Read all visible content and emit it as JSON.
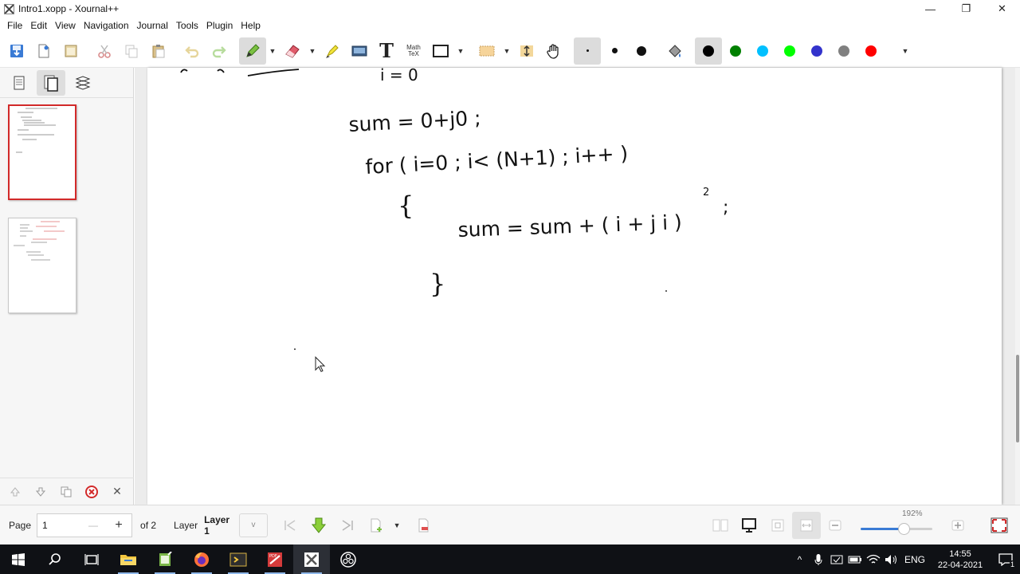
{
  "window": {
    "title": "Intro1.xopp - Xournal++",
    "minimize": "—",
    "restore": "❐",
    "close": "✕"
  },
  "menu": [
    "File",
    "Edit",
    "View",
    "Navigation",
    "Journal",
    "Tools",
    "Plugin",
    "Help"
  ],
  "toolbar": {
    "tools": [
      "save-icon",
      "new-page-icon",
      "open-icon",
      "cut-icon",
      "copy-icon",
      "paste-icon",
      "undo-icon",
      "redo-icon",
      "pen-icon",
      "eraser-icon",
      "highlighter-icon",
      "image-icon",
      "text-icon",
      "math-tex-icon",
      "shape-rectangle-icon",
      "select-rect-icon",
      "vertical-space-icon",
      "hand-icon"
    ],
    "math_tex_label": "Math TeX",
    "text_tool_label": "T",
    "pen_sizes": [
      "fine",
      "medium",
      "thick"
    ],
    "colors": [
      "#000000",
      "#008000",
      "#00c0ff",
      "#00ff00",
      "#3333cc",
      "#808080",
      "#ff0000"
    ],
    "accent": "#d22a2a"
  },
  "sidebar": {
    "tabs": [
      "page-preview-icon",
      "pages-icon",
      "layers-icon"
    ],
    "pages": [
      {
        "number": 1,
        "selected": true
      },
      {
        "number": 2,
        "selected": false
      }
    ]
  },
  "handwriting": {
    "line0": "i = 0",
    "line1": "sum = 0+j0 ;",
    "line2": "for ( i=0 ; i< (N+1) ; i++ )",
    "line3": "{",
    "line4": "sum = sum + ( i + j i )",
    "line4_exp": "2",
    "line4_end": ";",
    "line5": "}"
  },
  "status": {
    "page_label": "Page",
    "page_value": "1",
    "minus": "—",
    "plus": "+",
    "of_label": "of 2",
    "layer_label": "Layer",
    "layer_value": "Layer 1",
    "zoom": "192%",
    "zoom_level": 0.6
  },
  "taskbar": {
    "lang": "ENG",
    "time": "14:55",
    "date": "22-04-2021",
    "notification_count": "1"
  }
}
